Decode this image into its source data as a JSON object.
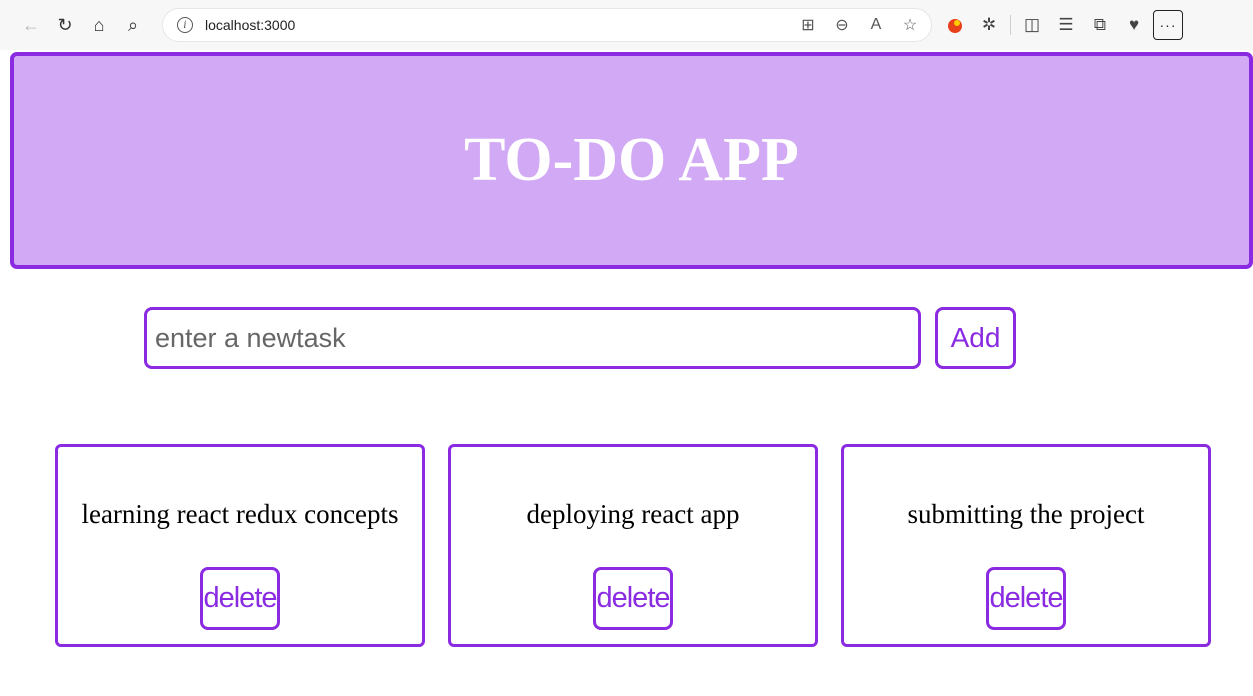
{
  "browser": {
    "url": "localhost:3000",
    "icons": {
      "back": "←",
      "reload": "↻",
      "home": "⌂",
      "search": "⌕",
      "info": "i",
      "app-grid": "⊞",
      "zoom-out": "⊖",
      "read-aloud": "A",
      "favorite": "☆",
      "extension": "●",
      "extensions-puzzle": "✲",
      "split-screen": "◫",
      "favorites-list": "☰",
      "collections": "⧉",
      "performance": "♥",
      "more": "···"
    }
  },
  "app": {
    "title": "TO-DO APP",
    "input_placeholder": "enter a newtask",
    "input_value": "",
    "add_label": "Add"
  },
  "tasks": [
    {
      "text": "learning react redux concepts",
      "delete_label": "delete"
    },
    {
      "text": "deploying react app",
      "delete_label": "delete"
    },
    {
      "text": "submitting the project",
      "delete_label": "delete"
    }
  ],
  "colors": {
    "accent": "#8a2be2",
    "header_background": "#d2a9f5",
    "title_text": "#ffffff"
  }
}
